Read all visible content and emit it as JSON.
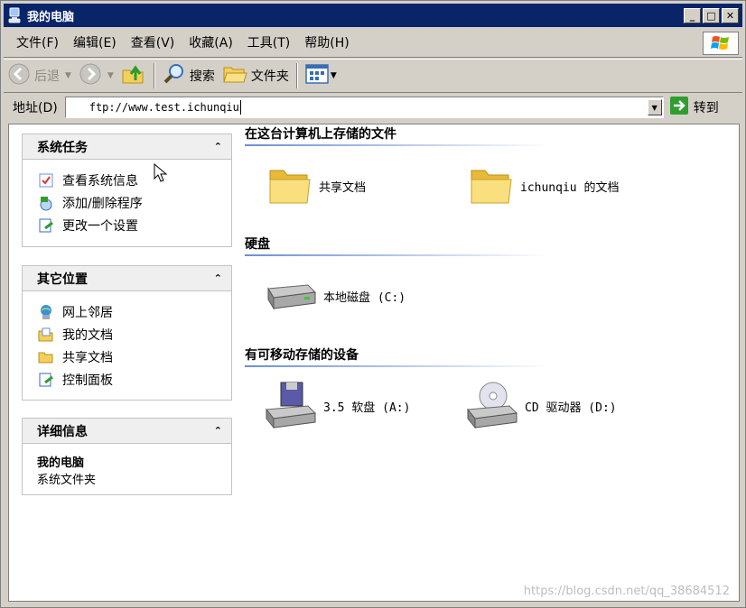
{
  "window": {
    "title": "我的电脑",
    "minimize": "_",
    "maximize": "□",
    "close": "✕"
  },
  "menubar": {
    "items": [
      "文件(F)",
      "编辑(E)",
      "查看(V)",
      "收藏(A)",
      "工具(T)",
      "帮助(H)"
    ]
  },
  "toolbar": {
    "back": "后退",
    "search": "搜索",
    "folders": "文件夹"
  },
  "address": {
    "label": "地址(D)",
    "value": "ftp://www.test.ichunqiu",
    "go": "转到"
  },
  "panels": {
    "system_tasks": {
      "title": "系统任务",
      "items": [
        "查看系统信息",
        "添加/删除程序",
        "更改一个设置"
      ]
    },
    "other_places": {
      "title": "其它位置",
      "items": [
        "网上邻居",
        "我的文档",
        "共享文档",
        "控制面板"
      ]
    },
    "details": {
      "title": "详细信息",
      "name": "我的电脑",
      "type": "系统文件夹"
    }
  },
  "sections": {
    "stored_files": {
      "title": "在这台计算机上存储的文件",
      "items": [
        "共享文档",
        "ichunqiu 的文档"
      ]
    },
    "hard_disks": {
      "title": "硬盘",
      "items": [
        "本地磁盘 (C:)"
      ]
    },
    "removable": {
      "title": "有可移动存储的设备",
      "items": [
        "3.5 软盘 (A:)",
        "CD 驱动器 (D:)"
      ]
    }
  },
  "watermark": "https://blog.csdn.net/qq_38684512",
  "colors": {
    "titlebar": "#0a246a",
    "chrome": "#d4d0c8",
    "folder": "#f4cf5a",
    "section_line": "#6b8fd4"
  }
}
